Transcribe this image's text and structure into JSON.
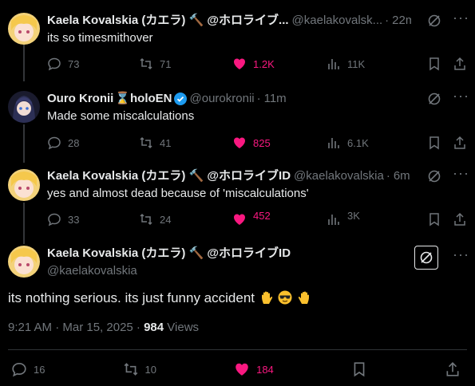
{
  "tweets": [
    {
      "name": "Kaela Kovalskia (カエラ) 🔨 @ホロライブ...",
      "handle": "@kaelakovalsk...",
      "time": "22m",
      "text": "its so timesmithover",
      "replies": "73",
      "reposts": "71",
      "likes": "1.2K",
      "views": "11K"
    },
    {
      "name": "Ouro Kronii",
      "name_suffix": "holoEN",
      "handle": "@ourokronii",
      "time": "11m",
      "text": "Made some miscalculations",
      "replies": "28",
      "reposts": "41",
      "likes": "825",
      "views": "6.1K"
    },
    {
      "name": "Kaela Kovalskia (カエラ) 🔨 @ホロライブID",
      "handle": "@kaelakovalskia",
      "time": "6m",
      "text": "yes and almost dead because of 'miscalculations'",
      "replies": "33",
      "reposts": "24",
      "likes": "452",
      "views": "3K"
    }
  ],
  "main": {
    "name": "Kaela Kovalskia (カエラ) 🔨 @ホロライブID",
    "handle": "@kaelakovalskia",
    "text": "its nothing serious. its just funny accident",
    "timestamp": "9:21 AM · Mar 15, 2025 ·",
    "views_count": "984",
    "views_label": "Views",
    "replies": "16",
    "reposts": "10",
    "likes": "184"
  },
  "colors": {
    "like": "#f91880",
    "muted": "#71767b",
    "text": "#e7e9ea",
    "verified": "#1d9bf0"
  },
  "icons": [
    "reply-icon",
    "repost-icon",
    "heart-icon",
    "views-icon",
    "bookmark-icon",
    "share-icon",
    "grok-icon",
    "more-icon"
  ]
}
